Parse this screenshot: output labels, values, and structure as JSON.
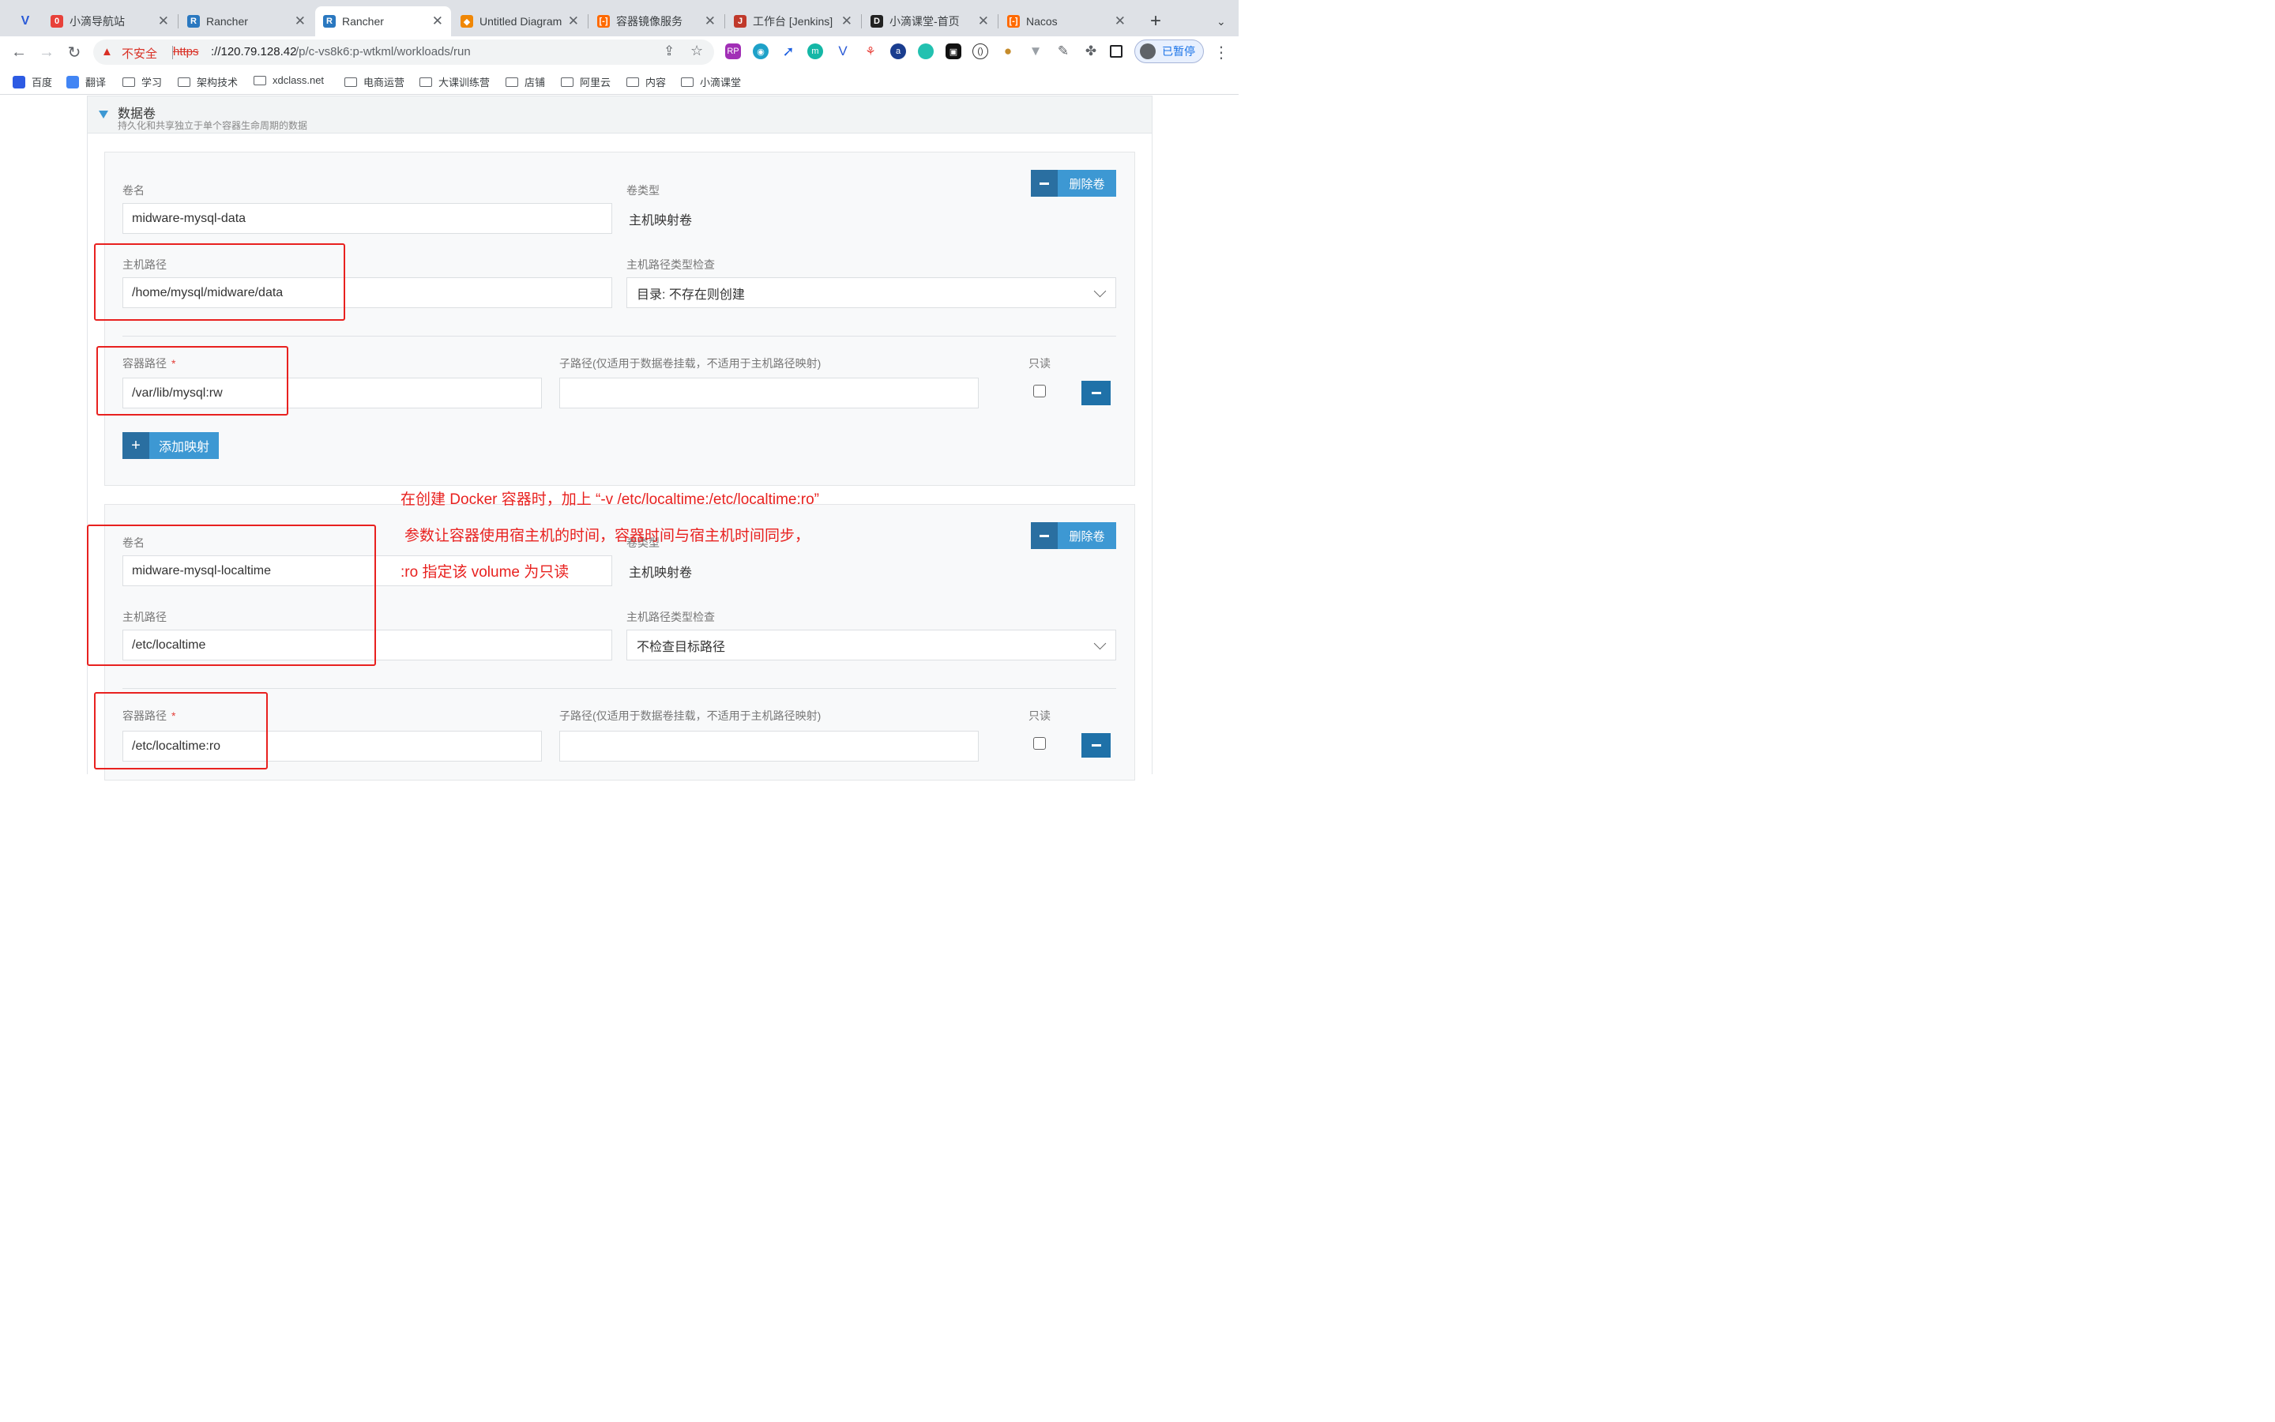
{
  "browser": {
    "tabs": [
      {
        "title": "",
        "icon": "vivaldi-logo-icon",
        "color": "#2a5ad7"
      },
      {
        "title": "小滴导航站",
        "icon": "xiaodi-nav-icon",
        "color": "#e8413a"
      },
      {
        "title": "Rancher",
        "icon": "rancher-icon",
        "color": "#2a78c0"
      },
      {
        "title": "Rancher",
        "icon": "rancher-icon",
        "color": "#2a78c0",
        "active": true
      },
      {
        "title": "Untitled Diagram",
        "icon": "drawio-icon",
        "color": "#f08705"
      },
      {
        "title": "容器镜像服务",
        "icon": "aliyun-icon",
        "color": "#ff6a00"
      },
      {
        "title": "工作台 [Jenkins]",
        "icon": "jenkins-icon",
        "color": "#c0392b"
      },
      {
        "title": "小滴课堂-首页",
        "icon": "xdclass-icon",
        "color": "#222222"
      },
      {
        "title": "Nacos",
        "icon": "aliyun-icon",
        "color": "#ff6a00"
      }
    ],
    "address": {
      "security_label": "不安全",
      "scheme": "https",
      "host": "://120.79.128.42",
      "path": "/p/c-vs8k6:p-wtkml/workloads/run"
    },
    "profile_label": "已暂停",
    "bookmarks": [
      "百度",
      "翻译",
      "学习",
      "架构技术",
      "xdclass.net",
      "电商运营",
      "大课训练营",
      "店铺",
      "阿里云",
      "内容",
      "小滴课堂"
    ]
  },
  "section": {
    "title": "数据卷",
    "subtitle": "持久化和共享独立于单个容器生命周期的数据"
  },
  "labels": {
    "volume_name": "卷名",
    "volume_type": "卷类型",
    "host_path": "主机路径",
    "host_path_check": "主机路径类型检查",
    "container_path": "容器路径",
    "required_mark": "*",
    "sub_path": "子路径(仅适用于数据卷挂载，不适用于主机路径映射)",
    "read_only": "只读",
    "remove_volume": "删除卷",
    "add_mapping": "添加映射"
  },
  "volumes": [
    {
      "name": "midware-mysql-data",
      "type": "主机映射卷",
      "host_path": "/home/mysql/midware/data",
      "host_path_check": "目录: 不存在则创建",
      "container_path": "/var/lib/mysql:rw",
      "sub_path": "",
      "read_only": false
    },
    {
      "name": "midware-mysql-localtime",
      "type": "主机映射卷",
      "host_path": "/etc/localtime",
      "host_path_check": "不检查目标路径",
      "container_path": "/etc/localtime:ro",
      "sub_path": "",
      "read_only": false
    }
  ],
  "annotation": {
    "line1": "在创建 Docker 容器时，加上 “-v /etc/localtime:/etc/localtime:ro”",
    "line2": "参数让容器使用宿主机的时间，容器时间与宿主机时间同步，",
    "line3": ":ro 指定该 volume 为只读"
  },
  "colors": {
    "accent": "#3d98d3",
    "accent_dark": "#2a6fa1",
    "annotation_red": "#e8211f",
    "insecure_red": "#d93025"
  }
}
